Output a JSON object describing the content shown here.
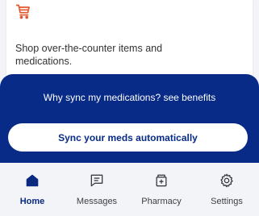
{
  "card": {
    "icon": "shopping-cart-icon",
    "text": "Shop over-the-counter items and medications."
  },
  "sync": {
    "heading": "Why sync my medications? see benefits",
    "button_label": "Sync your meds automatically"
  },
  "tabs": [
    {
      "label": "Home",
      "icon": "home-icon",
      "active": true
    },
    {
      "label": "Messages",
      "icon": "messages-icon",
      "active": false
    },
    {
      "label": "Pharmacy",
      "icon": "pharmacy-icon",
      "active": false
    },
    {
      "label": "Settings",
      "icon": "settings-gear-icon",
      "active": false
    }
  ],
  "colors": {
    "accent": "#082b88",
    "cart_icon": "#e4572e",
    "background": "#f2f4f8"
  }
}
